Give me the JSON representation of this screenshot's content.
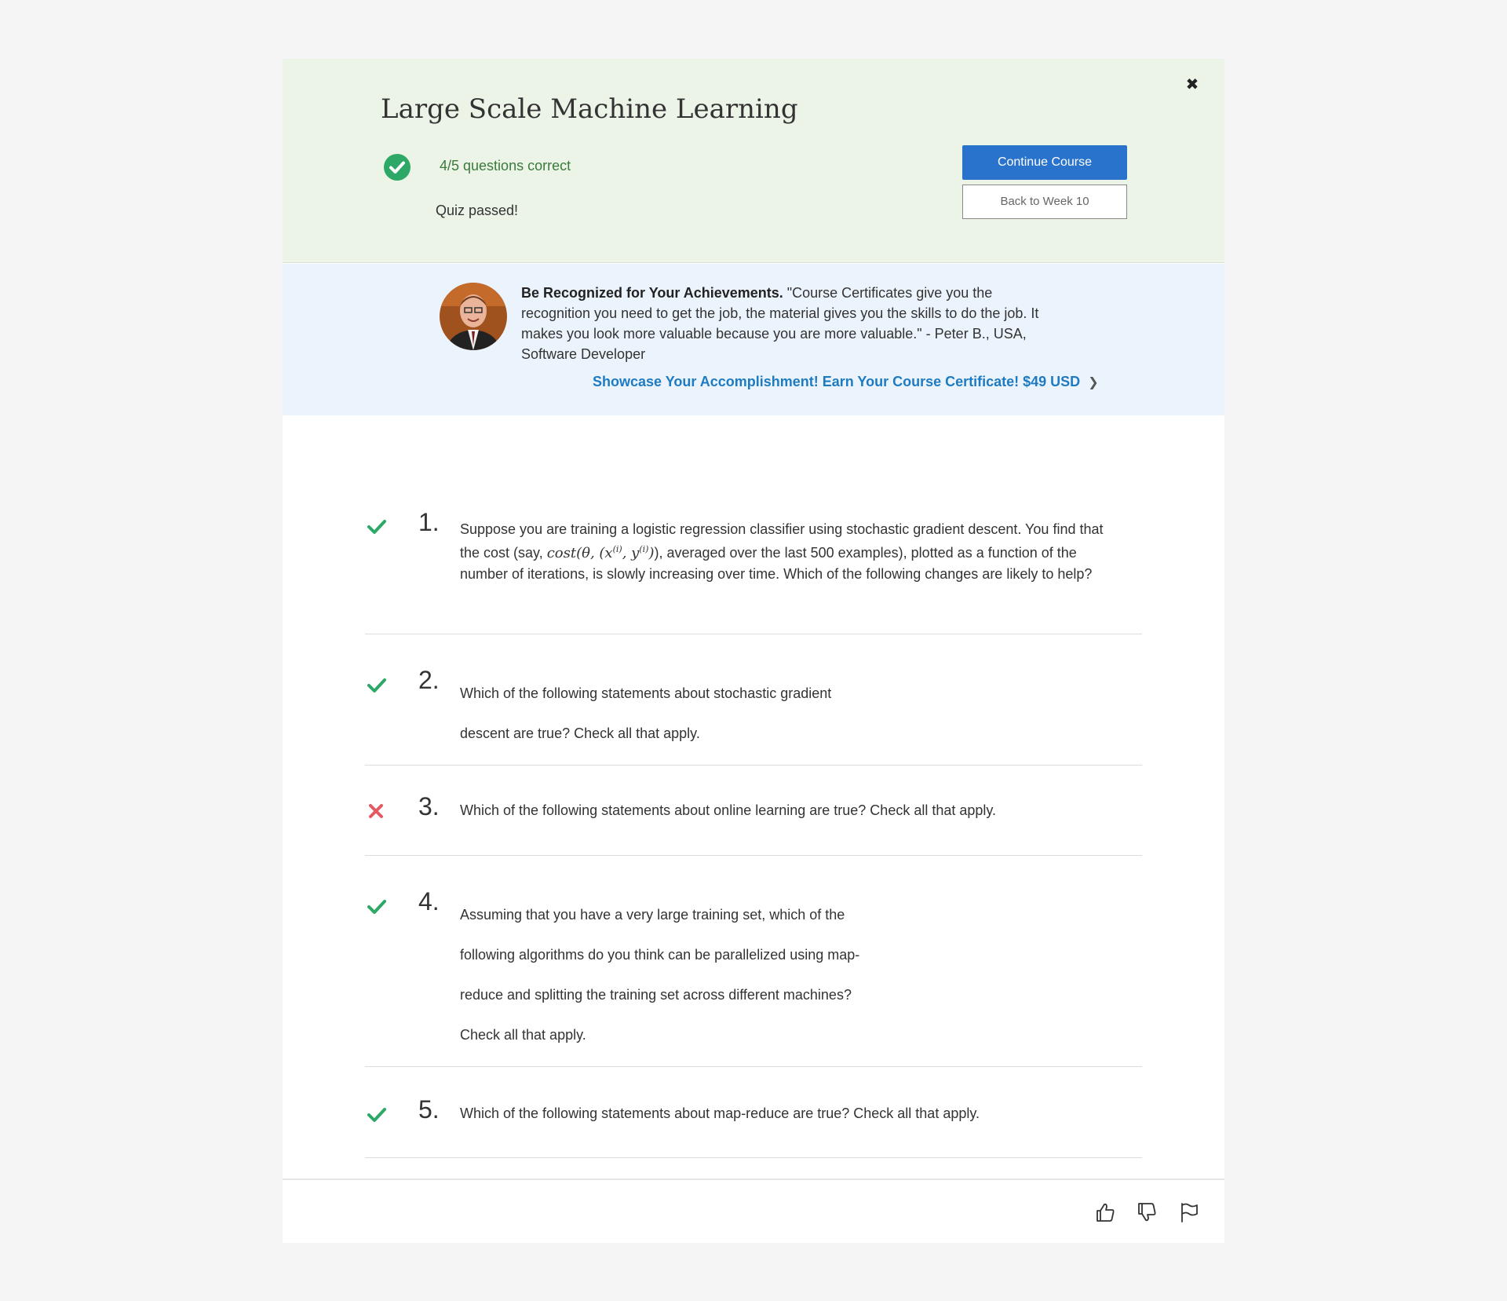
{
  "header": {
    "title": "Large Scale Machine Learning",
    "score": "4/5 questions correct",
    "status": "Quiz passed!",
    "continue_label": "Continue Course",
    "back_label": "Back to Week 10",
    "close_symbol": "✖"
  },
  "promo": {
    "heading": "Be Recognized for Your Achievements.",
    "quote": " \"Course Certificates give you the recognition you need to get the job, the material gives you the skills to do the job. It makes you look more valuable because you are more valuable.\" - Peter B., USA, Software Developer",
    "cta": "Showcase Your Accomplishment! Earn Your Course Certificate! $49 USD"
  },
  "questions": [
    {
      "number": "1.",
      "correct": true,
      "text_before": "Suppose you are training a logistic regression classifier using stochastic gradient descent. You find that the cost (say, ",
      "text_after": "), averaged over the last 500 examples), plotted as a function of the number of iterations, is slowly increasing over time. Which of the following changes are likely to help?"
    },
    {
      "number": "2.",
      "correct": true,
      "text": "Which of the following statements about stochastic gradient descent are true? Check all that apply."
    },
    {
      "number": "3.",
      "correct": false,
      "text": "Which of the following statements about online learning are true? Check all that apply."
    },
    {
      "number": "4.",
      "correct": true,
      "text": "Assuming that you have a very large training set, which of the following algorithms do you think can be parallelized using map-reduce and splitting the training set across different machines? Check all that apply."
    },
    {
      "number": "5.",
      "correct": true,
      "text": "Which of the following statements about map-reduce are true? Check all that apply."
    }
  ],
  "colors": {
    "correct": "#2ea866",
    "incorrect": "#e35a63",
    "primary_button": "#2a73cc",
    "link": "#1f7bc1",
    "header_bg": "#ecf4e7",
    "promo_bg": "#ebf4fc"
  },
  "icons": {
    "pass": "check-circle-icon",
    "correct": "checkmark-icon",
    "incorrect": "cross-icon",
    "like": "thumbs-up-icon",
    "dislike": "thumbs-down-icon",
    "flag": "flag-icon",
    "chevron": "chevron-right-icon"
  }
}
